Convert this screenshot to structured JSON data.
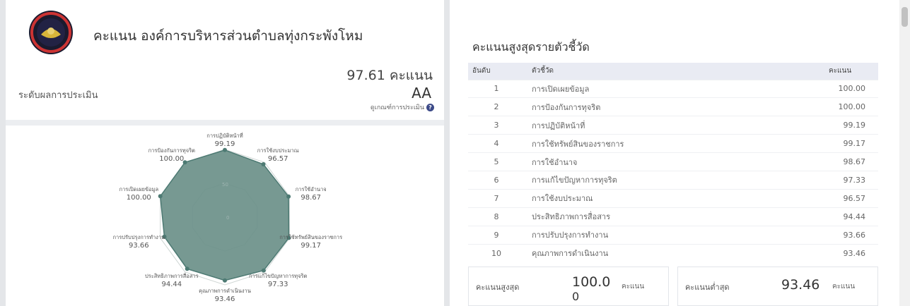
{
  "header": {
    "org_title": "คะแนน องค์การบริหารส่วนตำบลทุ่งกระพังโหม",
    "total_score": "97.61 คะแนน",
    "level_label": "ระดับผลการประเมิน",
    "level_value": "AA",
    "criteria_link": "ดูเกณฑ์การประเมิน"
  },
  "colors": {
    "accent": "#3c4a88",
    "radar_fill": "#6b9089",
    "radar_stroke": "#4d7a73"
  },
  "chart_data": {
    "type": "radar",
    "axis_ticks": [
      "0",
      "50"
    ],
    "rmax": 100,
    "categories": [
      {
        "label": "การปฏิบัติหน้าที่",
        "value": 99.19,
        "value_label": "99.19"
      },
      {
        "label": "การใช้งบประมาณ",
        "value": 96.57,
        "value_label": "96.57"
      },
      {
        "label": "การใช้อำนาจ",
        "value": 98.67,
        "value_label": "98.67"
      },
      {
        "label": "การใช้ทรัพย์สินของราชการ",
        "value": 99.17,
        "value_label": "99.17"
      },
      {
        "label": "การแก้ไขปัญหาการทุจริต",
        "value": 97.33,
        "value_label": "97.33"
      },
      {
        "label": "คุณภาพการดำเนินงาน",
        "value": 93.46,
        "value_label": "93.46"
      },
      {
        "label": "ประสิทธิภาพการสื่อสาร",
        "value": 94.44,
        "value_label": "94.44"
      },
      {
        "label": "การปรับปรุงการทำงาน",
        "value": 93.66,
        "value_label": "93.66"
      },
      {
        "label": "การเปิดเผยข้อมูล",
        "value": 100.0,
        "value_label": "100.00"
      },
      {
        "label": "การป้องกันการทุจริต",
        "value": 100.0,
        "value_label": "100.00"
      }
    ]
  },
  "ranking": {
    "title": "คะแนนสูงสุดรายตัวชี้วัด",
    "columns": [
      "อันดับ",
      "ตัวชี้วัด",
      "คะแนน"
    ],
    "rows": [
      {
        "rank": "1",
        "name": "การเปิดเผยข้อมูล",
        "score": "100.00"
      },
      {
        "rank": "2",
        "name": "การป้องกันการทุจริต",
        "score": "100.00"
      },
      {
        "rank": "3",
        "name": "การปฏิบัติหน้าที่",
        "score": "99.19"
      },
      {
        "rank": "4",
        "name": "การใช้ทรัพย์สินของราชการ",
        "score": "99.17"
      },
      {
        "rank": "5",
        "name": "การใช้อำนาจ",
        "score": "98.67"
      },
      {
        "rank": "6",
        "name": "การแก้ไขปัญหาการทุจริต",
        "score": "97.33"
      },
      {
        "rank": "7",
        "name": "การใช้งบประมาณ",
        "score": "96.57"
      },
      {
        "rank": "8",
        "name": "ประสิทธิภาพการสื่อสาร",
        "score": "94.44"
      },
      {
        "rank": "9",
        "name": "การปรับปรุงการทำงาน",
        "score": "93.66"
      },
      {
        "rank": "10",
        "name": "คุณภาพการดำเนินงาน",
        "score": "93.46"
      }
    ]
  },
  "summary": {
    "max_label": "คะแนนสูงสุด",
    "max_value": "100.0",
    "max_value_wrap": "0",
    "max_unit": "คะแนน",
    "min_label": "คะแนนต่ำสุด",
    "min_value": "93.46",
    "min_unit": "คะแนน"
  }
}
